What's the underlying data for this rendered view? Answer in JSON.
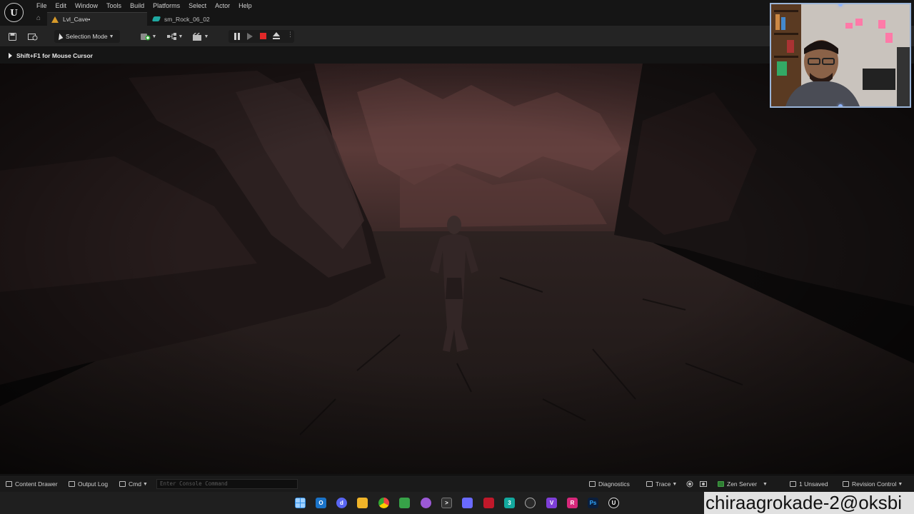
{
  "menu": [
    "File",
    "Edit",
    "Window",
    "Tools",
    "Build",
    "Platforms",
    "Select",
    "Actor",
    "Help"
  ],
  "logo": "U",
  "tabs": [
    {
      "label": "Lvl_Cave•",
      "icon": "level-icon"
    },
    {
      "label": "sm_Rock_06_02",
      "icon": "static-mesh-icon"
    }
  ],
  "toolbar": {
    "selection_mode": "Selection Mode"
  },
  "viewport": {
    "hint": "Shift+F1 for Mouse Cursor"
  },
  "statusbar": {
    "content_drawer": "Content Drawer",
    "output_log": "Output Log",
    "cmd": "Cmd",
    "console_placeholder": "Enter Console Command",
    "diagnostics": "Diagnostics",
    "trace": "Trace",
    "zen_server": "Zen Server",
    "unsaved": "1 Unsaved",
    "revision_control": "Revision Control"
  },
  "taskbar_icons": [
    "windows-start-icon",
    "outlook-icon",
    "discord-icon",
    "file-explorer-icon",
    "chrome-icon",
    "notepad-icon",
    "obs-icon",
    "terminal-icon",
    "snipping-icon",
    "pdf-icon",
    "substance-icon",
    "headset-icon",
    "visual-studio-icon",
    "rider-icon",
    "photoshop-icon",
    "unreal-icon"
  ],
  "watermark": "chiraagrokade-2@oksbi",
  "colors": {
    "stop": "#e02828",
    "level_tab": "#d79a2a",
    "mesh_tab": "#1fa8a1"
  }
}
